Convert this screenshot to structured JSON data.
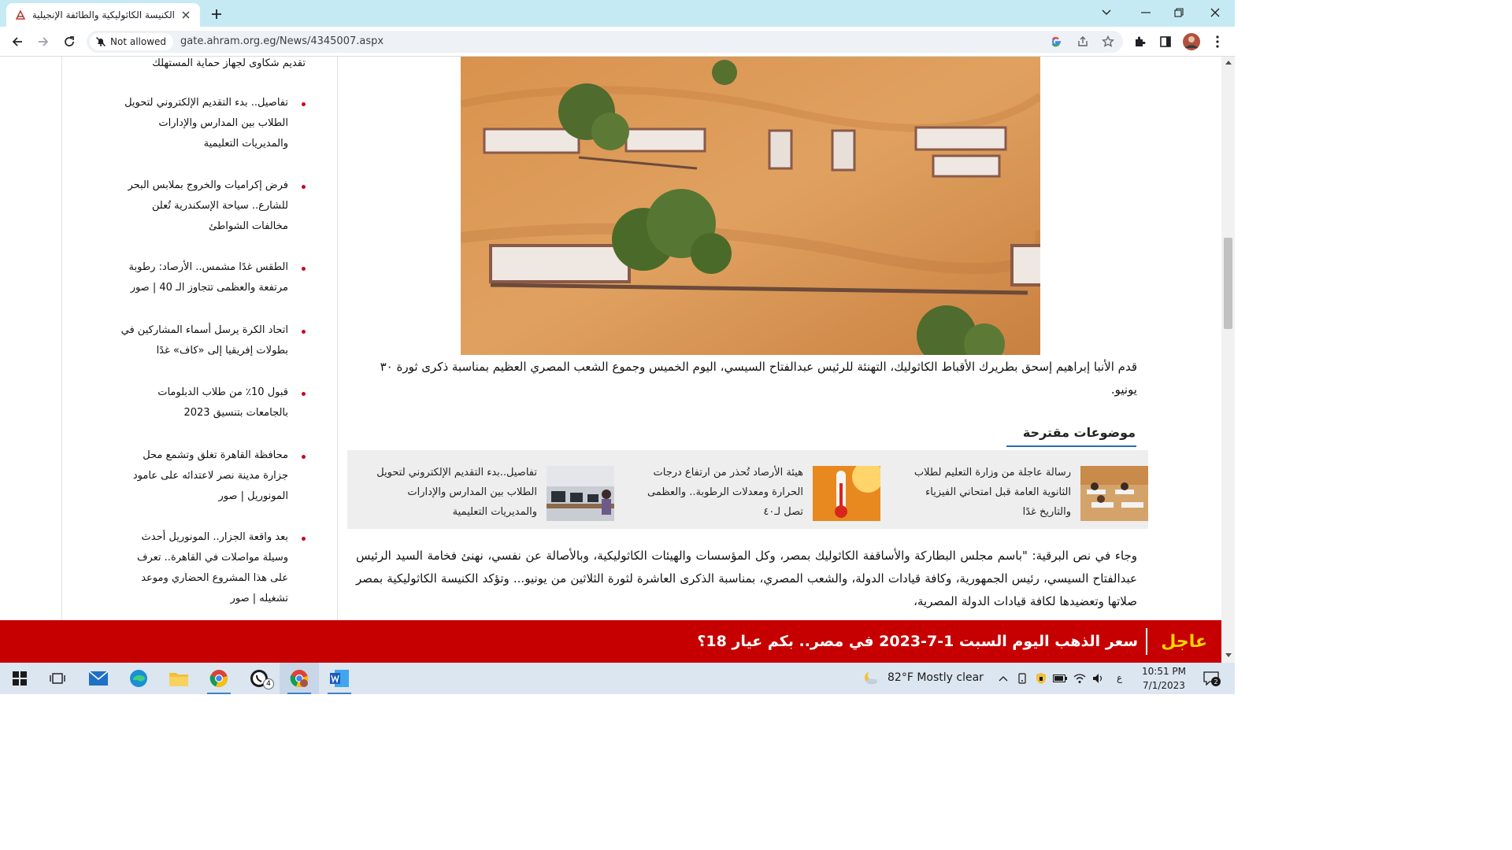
{
  "browser": {
    "tab_title": "الكنيسة الكاثوليكية والطائفة الإنجيلية",
    "chip_label": "Not allowed",
    "url": "gate.ahram.org.eg/News/4345007.aspx"
  },
  "sidebar": {
    "items": [
      {
        "label": "تقديم شكاوى لجهاز حماية المستهلك"
      },
      {
        "label": "تفاصيل.. بدء التقديم الإلكتروني لتحويل الطلاب بين المدارس والإدارات والمديريات التعليمية"
      },
      {
        "label": "فرض إكراميات والخروج بملابس البحر للشارع.. سياحة الإسكندرية تُعلن مخالفات الشواطئ"
      },
      {
        "label": "الطقس غدًا مشمس.. الأرصاد: رطوبة مرتفعة والعظمى تتجاوز الـ 40 | صور"
      },
      {
        "label": "اتحاد الكرة يرسل أسماء المشاركين في بطولات إفريقيا إلى «كاف» غدًا"
      },
      {
        "label": "قبول 10٪ من طلاب الدبلومات بالجامعات بتنسيق 2023"
      },
      {
        "label": "محافظة القاهرة تغلق وتشمع محل جزارة مدينة نصر لاعتدائه على عامود المونوريل | صور"
      },
      {
        "label": "بعد واقعة الجزار.. المونوريل أحدث وسيلة مواصلات في القاهرة.. تعرف على هذا المشروع الحضاري وموعد تشغيله | صور"
      }
    ]
  },
  "article": {
    "caption": "قدم الأنبا إبراهيم إسحق بطريرك الأقباط الكاثوليك، التهنئة للرئيس عبدالفتاح السيسي، اليوم الخميس وجموع الشعب المصري العظيم بمناسبة ذكرى ثورة ٣٠ يونيو.",
    "suggested_title": "موضوعات مقترحة",
    "suggested": [
      {
        "text": "رسالة عاجلة من وزارة التعليم لطلاب الثانوية العامة قبل امتحاني الفيزياء والتاريخ غدًا"
      },
      {
        "text": "هيئة الأرصاد تُحذر من ارتفاع درجات الحرارة ومعدلات الرطوبة.. والعظمى تصل لـ٤٠"
      },
      {
        "text": "تفاصيل..بدء التقديم الإلكتروني لتحويل الطلاب بين المدارس والإدارات والمديريات التعليمية"
      }
    ],
    "body": "وجاء في نص البرقية: \"باسم مجلس البطاركة والأساقفة الكاثوليك بمصر، وكل المؤسسات والهيئات الكاثوليكية، وبالأصالة عن نفسي، نهنئ فخامة السيد الرئيس عبدالفتاح السيسي، رئيس الجمهورية، وكافة قيادات الدولة، والشعب المصري، بمناسبة الذكرى العاشرة لثورة الثلاثين من يونيو... وتؤكد الكنيسة الكاثوليكية بمصر صلاتها وتعضيدها لكافة قيادات الدولة المصرية،"
  },
  "breaking": {
    "label": "عاجل",
    "text": "سعر الذهب اليوم السبت 1-7-2023 في مصر.. بكم عيار 18؟"
  },
  "taskbar": {
    "weather": "82°F  Mostly clear",
    "lang": "ع",
    "time": "10:51 PM",
    "date": "7/1/2023",
    "whatsapp_badge": "4",
    "notif_badge": "2"
  },
  "colors": {
    "breaking_bg": "#c60000",
    "breaking_label": "#ffd400",
    "bullet": "#d0021b",
    "tabstrip": "#c5eaf3"
  },
  "icons": [
    "back-icon",
    "forward-icon",
    "reload-icon",
    "google-icon",
    "share-icon",
    "star-icon",
    "extensions-icon",
    "sidepanel-icon",
    "menu-icon"
  ]
}
